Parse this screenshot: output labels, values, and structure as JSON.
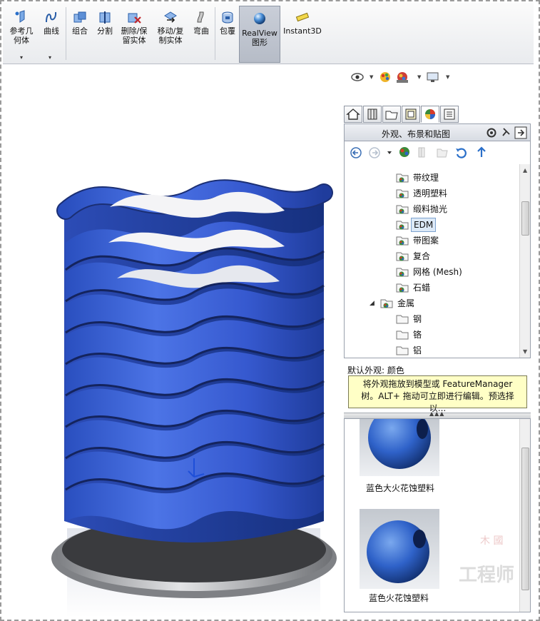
{
  "ribbon": {
    "buttons": [
      {
        "id": "ref-geometry",
        "label_l1": "参考几",
        "label_l2": "何体"
      },
      {
        "id": "curves",
        "label_l1": "曲线",
        "label_l2": ""
      },
      {
        "id": "combine",
        "label_l1": "组合",
        "label_l2": ""
      },
      {
        "id": "split",
        "label_l1": "分割",
        "label_l2": ""
      },
      {
        "id": "delete-keep-body",
        "label_l1": "删除/保",
        "label_l2": "留实体"
      },
      {
        "id": "move-copy-body",
        "label_l1": "移动/复",
        "label_l2": "制实体"
      },
      {
        "id": "flex",
        "label_l1": "弯曲",
        "label_l2": ""
      },
      {
        "id": "wrap",
        "label_l1": "包覆",
        "label_l2": ""
      },
      {
        "id": "realview",
        "label_l1": "RealView",
        "label_l2": "图形"
      },
      {
        "id": "instant3d",
        "label_l1": "Instant3D",
        "label_l2": ""
      }
    ]
  },
  "taskpane": {
    "title": "外观、布景和贴图",
    "tree": [
      {
        "label": "带纹理",
        "level": 2
      },
      {
        "label": "透明塑料",
        "level": 2
      },
      {
        "label": "缎料抛光",
        "level": 2
      },
      {
        "label": "EDM",
        "level": 2,
        "selected": true
      },
      {
        "label": "带图案",
        "level": 2
      },
      {
        "label": "复合",
        "level": 2
      },
      {
        "label": "网格 (Mesh)",
        "level": 2
      },
      {
        "label": "石蜡",
        "level": 2
      },
      {
        "label": "金属",
        "level": 1,
        "expanded": true
      },
      {
        "label": "钢",
        "level": 2
      },
      {
        "label": "铬",
        "level": 2
      },
      {
        "label": "铝",
        "level": 2
      }
    ],
    "default_appearance": "默认外观: 颜色",
    "tooltip_l1": "将外观拖放到模型或 FeatureManager",
    "tooltip_l2": "树。ALT+ 拖动可立即进行编辑。预选择以...",
    "gallery": [
      {
        "label": "蓝色大火花蚀塑料"
      },
      {
        "label": "蓝色火花蚀塑料"
      }
    ]
  },
  "watermark": {
    "line1": "木 國",
    "line2": "工程师"
  },
  "colors": {
    "model_blue": "#3a5fd6",
    "ribbon_bg": "#eceef1",
    "tooltip_bg": "#ffffc6",
    "selection": "#dce9f7"
  }
}
